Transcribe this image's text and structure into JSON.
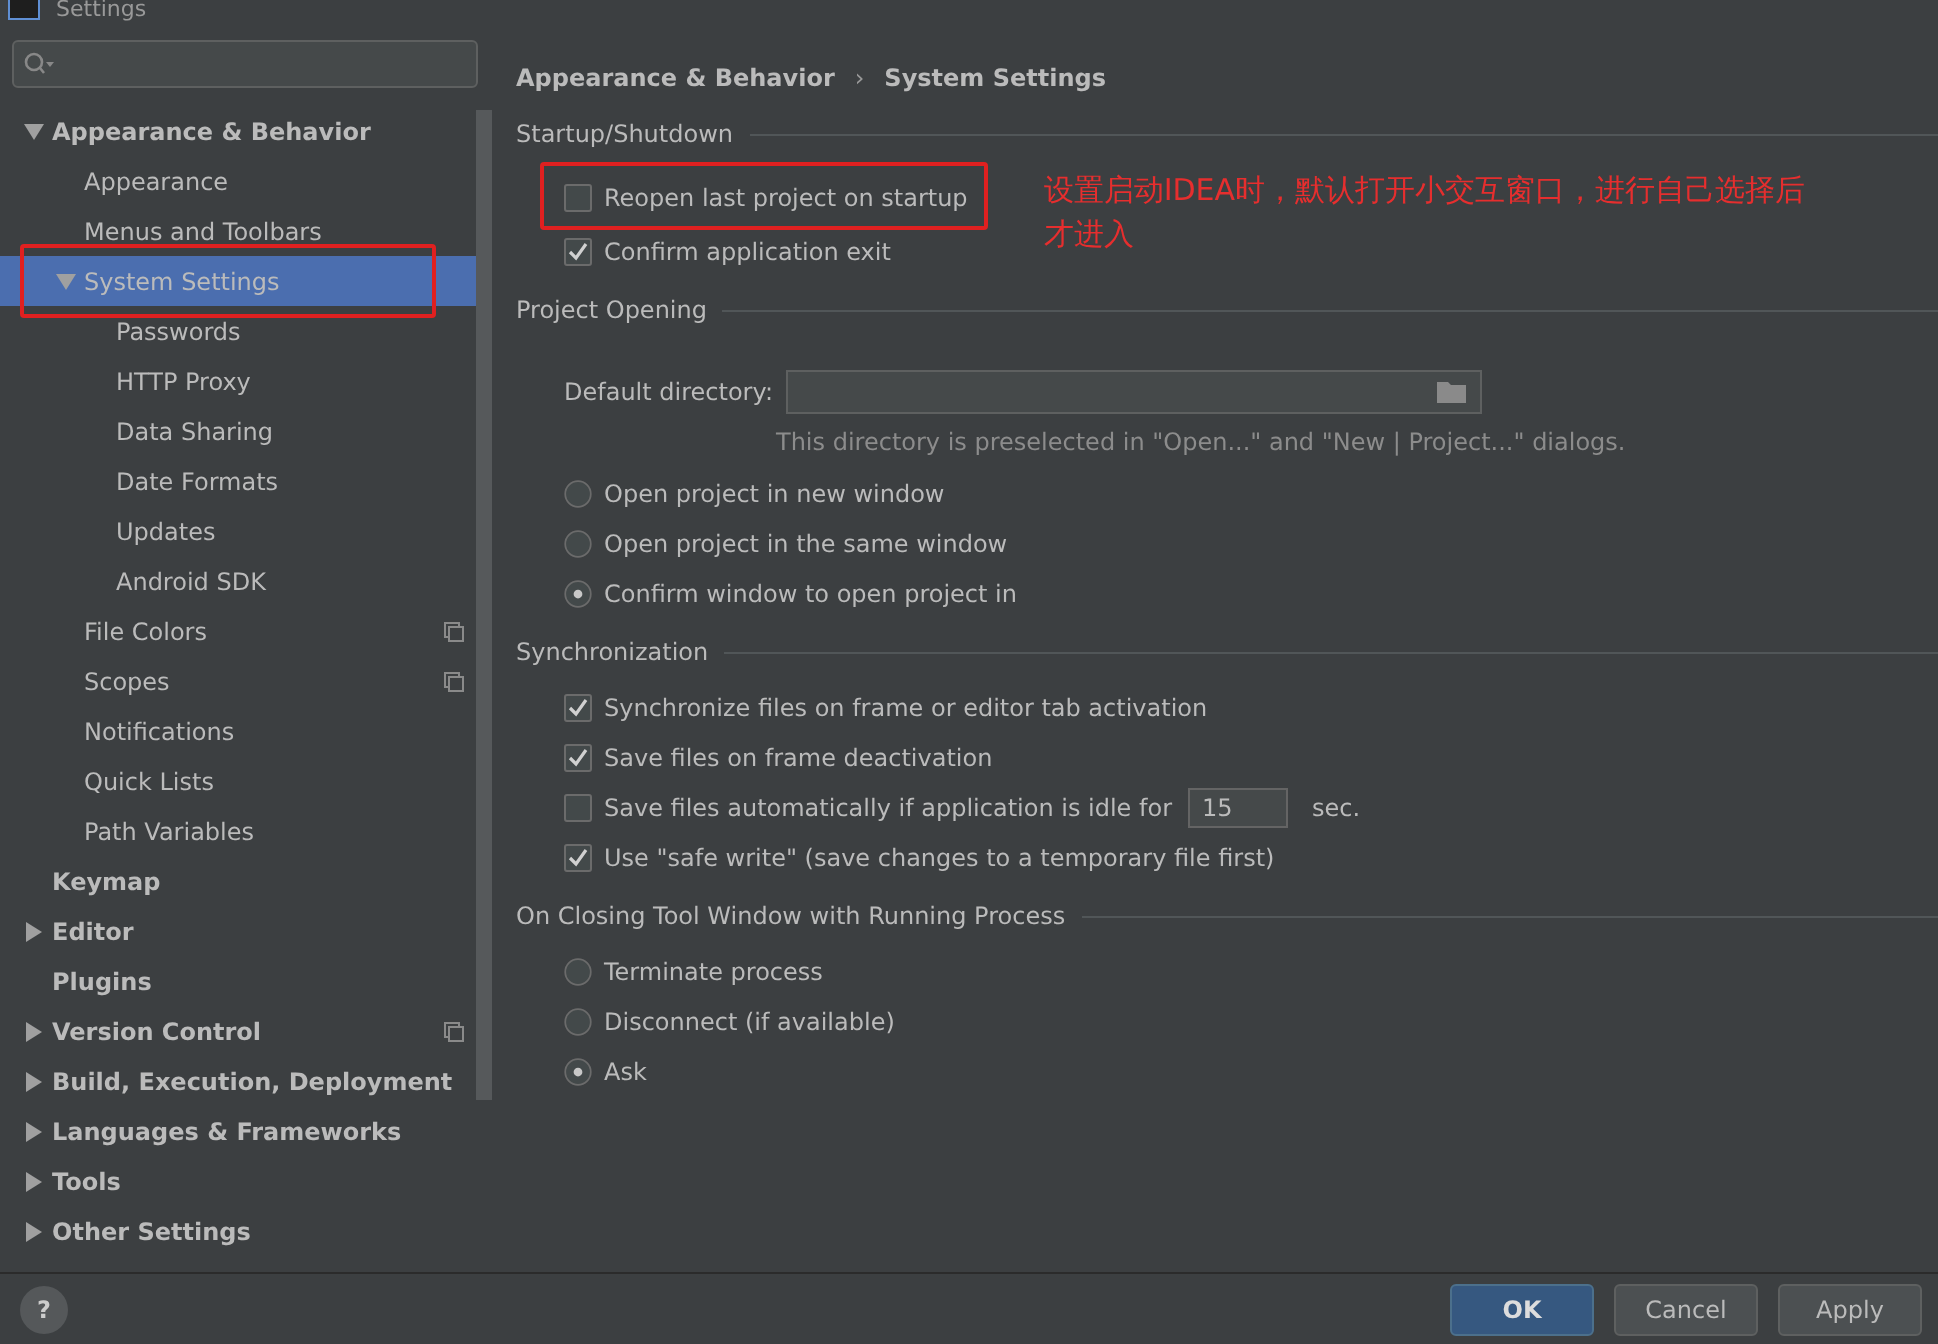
{
  "window": {
    "title": "Settings"
  },
  "tree": [
    {
      "label": "Appearance & Behavior",
      "selected": false,
      "highlighted": false,
      "icon": false,
      "expanded": true,
      "children": [
        {
          "label": "Appearance",
          "selected": false,
          "highlighted": false,
          "icon": false
        },
        {
          "label": "Menus and Toolbars",
          "selected": false,
          "highlighted": false,
          "icon": false
        },
        {
          "label": "System Settings",
          "selected": true,
          "highlighted": true,
          "icon": false,
          "expanded": true,
          "children": [
            {
              "label": "Passwords",
              "selected": false,
              "highlighted": false,
              "icon": false
            },
            {
              "label": "HTTP Proxy",
              "selected": false,
              "highlighted": false,
              "icon": false
            },
            {
              "label": "Data Sharing",
              "selected": false,
              "highlighted": false,
              "icon": false
            },
            {
              "label": "Date Formats",
              "selected": false,
              "highlighted": false,
              "icon": false
            },
            {
              "label": "Updates",
              "selected": false,
              "highlighted": false,
              "icon": false
            },
            {
              "label": "Android SDK",
              "selected": false,
              "highlighted": false,
              "icon": false
            }
          ]
        },
        {
          "label": "File Colors",
          "selected": false,
          "highlighted": false,
          "icon": true
        },
        {
          "label": "Scopes",
          "selected": false,
          "highlighted": false,
          "icon": true
        },
        {
          "label": "Notifications",
          "selected": false,
          "highlighted": false,
          "icon": false
        },
        {
          "label": "Quick Lists",
          "selected": false,
          "highlighted": false,
          "icon": false
        },
        {
          "label": "Path Variables",
          "selected": false,
          "highlighted": false,
          "icon": false
        }
      ]
    },
    {
      "label": "Keymap",
      "selected": false,
      "highlighted": false,
      "icon": false
    },
    {
      "label": "Editor",
      "selected": false,
      "highlighted": false,
      "icon": false,
      "expanded": false
    },
    {
      "label": "Plugins",
      "selected": false,
      "highlighted": false,
      "icon": false
    },
    {
      "label": "Version Control",
      "selected": false,
      "highlighted": false,
      "icon": true,
      "expanded": false
    },
    {
      "label": "Build, Execution, Deployment",
      "selected": false,
      "highlighted": false,
      "icon": false,
      "expanded": false
    },
    {
      "label": "Languages & Frameworks",
      "selected": false,
      "highlighted": false,
      "icon": false,
      "expanded": false
    },
    {
      "label": "Tools",
      "selected": false,
      "highlighted": false,
      "icon": false,
      "expanded": false
    },
    {
      "label": "Other Settings",
      "selected": false,
      "highlighted": false,
      "icon": false,
      "expanded": false
    }
  ],
  "breadcrumb": {
    "separator": "›",
    "items": [
      "Appearance & Behavior",
      "System Settings"
    ]
  },
  "sections": [
    {
      "title": "Startup/Shutdown",
      "note": "设置启动IDEA时，默认打开小交互窗口，进行自己选择后才进入",
      "items": [
        {
          "kind": "checkbox",
          "label": "Reopen last project on startup",
          "checked": false,
          "highlighted": true
        },
        {
          "kind": "checkbox",
          "label": "Confirm application exit",
          "checked": true,
          "highlighted": false
        }
      ]
    },
    {
      "title": "Project Opening",
      "items": [
        {
          "kind": "directory",
          "label": "Default directory:"
        },
        {
          "kind": "hint",
          "text": "This directory is preselected in \"Open...\" and \"New | Project...\" dialogs."
        },
        {
          "kind": "radio",
          "label": "Open project in new window",
          "selected": false
        },
        {
          "kind": "radio",
          "label": "Open project in the same window",
          "selected": false
        },
        {
          "kind": "radio",
          "label": "Confirm window to open project in",
          "selected": true
        }
      ]
    },
    {
      "title": "Synchronization",
      "items": [
        {
          "kind": "checkbox",
          "label": "Synchronize files on frame or editor tab activation",
          "checked": true,
          "highlighted": false
        },
        {
          "kind": "checkbox",
          "label": "Save files on frame deactivation",
          "checked": true,
          "highlighted": false
        },
        {
          "kind": "checkbox_input",
          "label": "Save files automatically if application is idle for",
          "checked": false,
          "value": "15",
          "unit": "sec."
        },
        {
          "kind": "checkbox",
          "label": "Use \"safe write\" (save changes to a temporary file first)",
          "checked": true,
          "highlighted": false
        }
      ]
    },
    {
      "title": "On Closing Tool Window with Running Process",
      "items": [
        {
          "kind": "radio",
          "label": "Terminate process",
          "selected": false
        },
        {
          "kind": "radio",
          "label": "Disconnect (if available)",
          "selected": false
        },
        {
          "kind": "radio",
          "label": "Ask",
          "selected": true
        }
      ]
    }
  ],
  "footer": {
    "help": "?",
    "buttons": [
      {
        "label": "OK",
        "default": true
      },
      {
        "label": "Cancel",
        "default": false
      },
      {
        "label": "Apply",
        "default": false
      }
    ]
  }
}
